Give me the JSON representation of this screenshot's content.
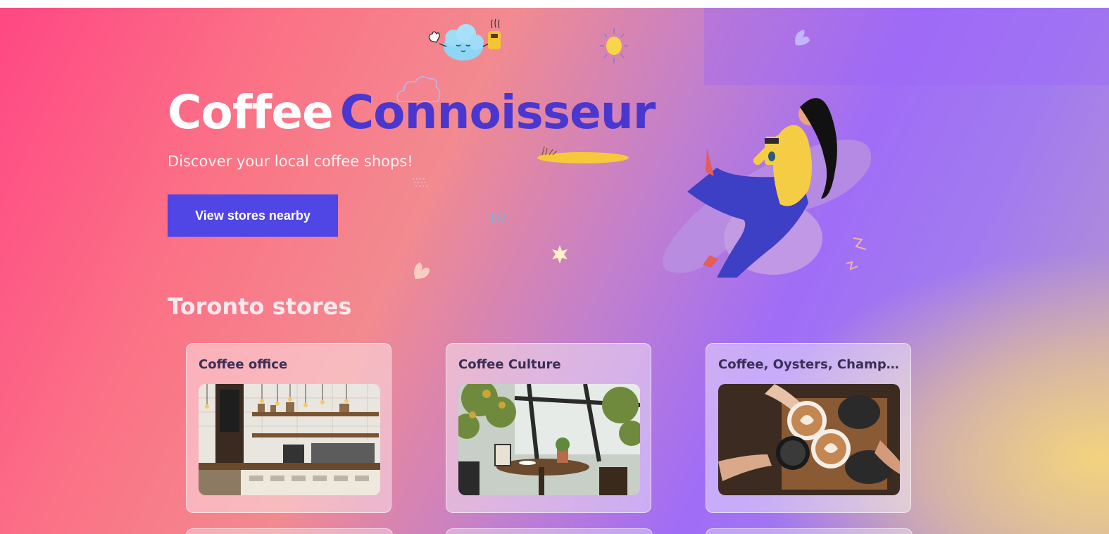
{
  "hero": {
    "title_word_1": "Coffee",
    "title_word_2": "Connoisseur",
    "subtitle": "Discover your local coffee shops!",
    "cta_label": "View stores nearby"
  },
  "stores_section": {
    "title": "Toronto stores",
    "stores": [
      {
        "name": "Coffee office",
        "photo": "cafe-counter-photo"
      },
      {
        "name": "Coffee Culture",
        "photo": "cafe-window-table-photo"
      },
      {
        "name": "Coffee, Oysters, Champa...",
        "photo": "latte-cheers-photo"
      }
    ]
  },
  "colors": {
    "brand_primary": "#4f46e5",
    "title_accent": "#4a37cf",
    "gradient_pink": "#ff4784",
    "gradient_purple": "#a06df6",
    "gradient_yellow": "#f6d67a"
  }
}
